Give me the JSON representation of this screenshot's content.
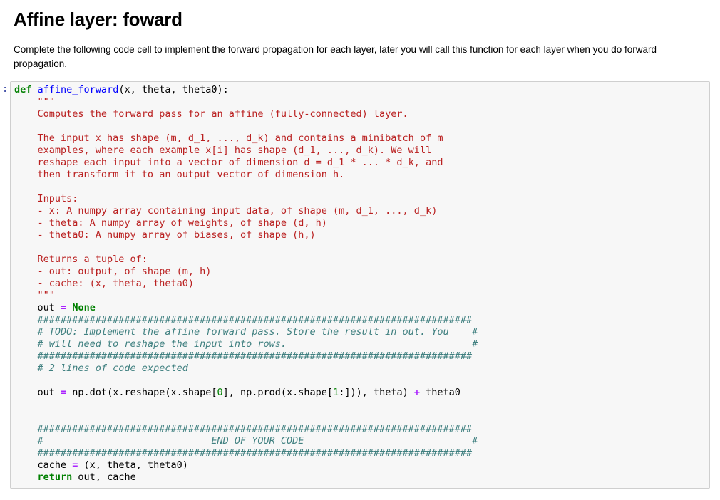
{
  "markdown": {
    "title": "Affine layer: foward",
    "description": "Complete the following code cell to implement the forward propagation for each layer, later you will call this function for each layer when you do forward propagation."
  },
  "cell": {
    "prompt": ":",
    "code": {
      "l1": {
        "def": "def",
        "name": "affine_forward",
        "params": "(x, theta, theta0):"
      },
      "doc_open": "    \"\"\"",
      "doc_lines": [
        "    Computes the forward pass for an affine (fully-connected) layer.",
        "",
        "    The input x has shape (m, d_1, ..., d_k) and contains a minibatch of m",
        "    examples, where each example x[i] has shape (d_1, ..., d_k). We will",
        "    reshape each input into a vector of dimension d = d_1 * ... * d_k, and",
        "    then transform it to an output vector of dimension h.",
        "",
        "    Inputs:",
        "    - x: A numpy array containing input data, of shape (m, d_1, ..., d_k)",
        "    - theta: A numpy array of weights, of shape (d, h)",
        "    - theta0: A numpy array of biases, of shape (h,)",
        "",
        "    Returns a tuple of:",
        "    - out: output, of shape (m, h)",
        "    - cache: (x, theta, theta0)"
      ],
      "doc_close": "    \"\"\"",
      "out_none": {
        "lhs": "    out ",
        "eq": "=",
        "val": "None"
      },
      "hash_line": "    ###########################################################################",
      "todo1": "    # TODO: Implement the affine forward pass. Store the result in out. You    #",
      "todo2": "    # will need to reshape the input into rows.                                #",
      "expected": "    # 2 lines of code expected",
      "impl": {
        "a": "    out ",
        "eq": "=",
        "b": " np.dot(x.reshape(x.shape[",
        "n0": "0",
        "c": "], np.prod(x.shape[",
        "n1": "1",
        "d": ":])), theta) ",
        "plus": "+",
        "e": " theta0"
      },
      "end_line": "    #                             END OF YOUR CODE                             #",
      "cache": {
        "a": "    cache ",
        "eq": "=",
        "b": " (x, theta, theta0)"
      },
      "ret": {
        "kw": "return",
        "rest": " out, cache"
      }
    }
  }
}
